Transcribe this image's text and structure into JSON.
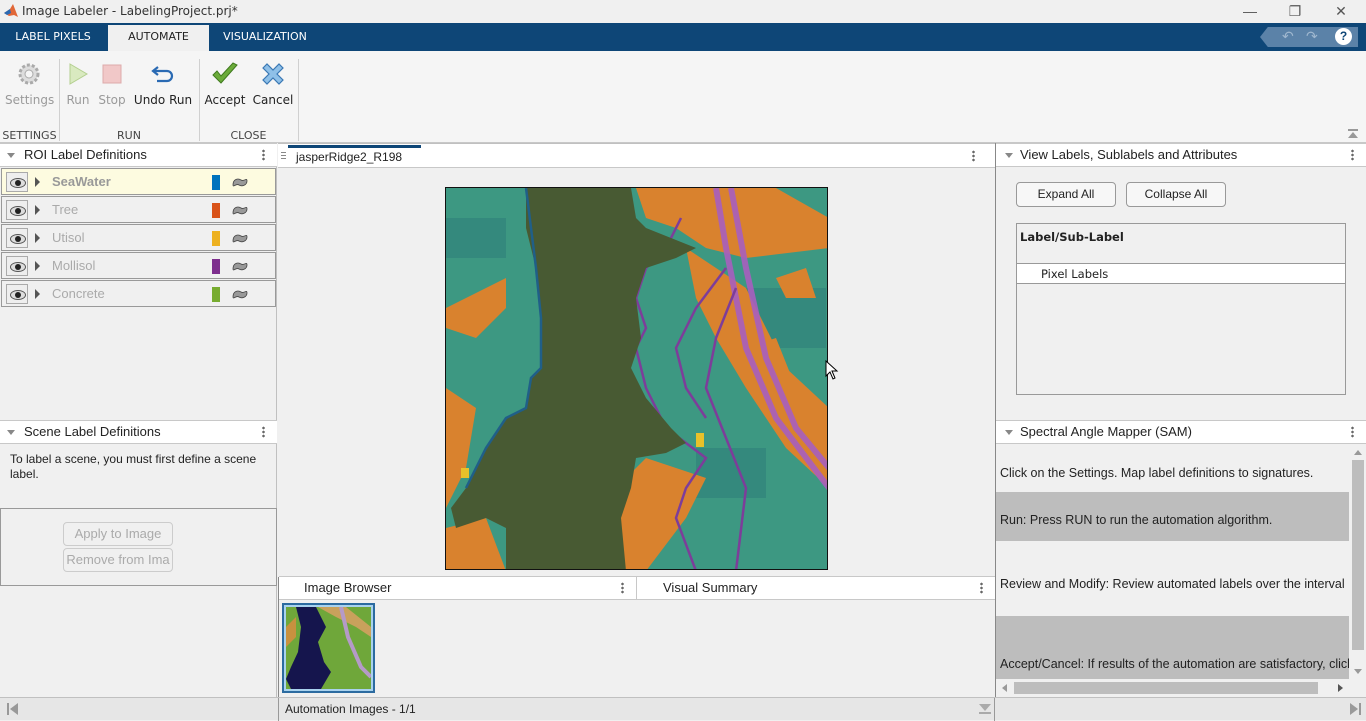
{
  "window": {
    "title": "Image Labeler - LabelingProject.prj*",
    "controls": [
      "minimize",
      "restore",
      "close"
    ]
  },
  "tabs": [
    {
      "label": "LABEL PIXELS",
      "active": false
    },
    {
      "label": "AUTOMATE",
      "active": true
    },
    {
      "label": "VISUALIZATION",
      "active": false
    }
  ],
  "quick_access": [
    "undo-icon",
    "redo-icon",
    "help-icon"
  ],
  "toolstrip": {
    "settings": {
      "label": "Settings",
      "enabled": false
    },
    "run": {
      "label": "Run",
      "enabled": false
    },
    "stop": {
      "label": "Stop",
      "enabled": false
    },
    "undo_run": {
      "label": "Undo Run",
      "enabled": true
    },
    "accept": {
      "label": "Accept",
      "enabled": true
    },
    "cancel": {
      "label": "Cancel",
      "enabled": true
    },
    "sections": {
      "settings": "SETTINGS",
      "run": "RUN",
      "close": "CLOSE"
    }
  },
  "roi_panel": {
    "title": "ROI Label Definitions",
    "labels": [
      {
        "name": "SeaWater",
        "color": "#0072bd",
        "selected": true
      },
      {
        "name": "Tree",
        "color": "#d95319",
        "selected": false
      },
      {
        "name": "Utisol",
        "color": "#edb120",
        "selected": false
      },
      {
        "name": "Mollisol",
        "color": "#7e2f8e",
        "selected": false
      },
      {
        "name": "Concrete",
        "color": "#77ac30",
        "selected": false
      }
    ]
  },
  "scene_panel": {
    "title": "Scene Label Definitions",
    "message": "To label a scene, you must first define a scene label.",
    "apply_button": "Apply to Image",
    "remove_button": "Remove from Ima"
  },
  "document": {
    "tab_label": "jasperRidge2_R198"
  },
  "image_browser": {
    "title": "Image Browser",
    "status": "Automation Images - 1/1"
  },
  "visual_summary": {
    "title": "Visual Summary"
  },
  "view_labels_panel": {
    "title": "View Labels, Sublabels and Attributes",
    "expand_all": "Expand All",
    "collapse_all": "Collapse All",
    "table_header": "Label/Sub-Label",
    "rows": [
      "Pixel Labels"
    ]
  },
  "sam_panel": {
    "title": "Spectral Angle Mapper (SAM)",
    "steps": [
      {
        "text": "Click on the Settings. Map label definitions to signatures.",
        "highlight": false
      },
      {
        "text": "Run: Press RUN to run the automation algorithm.",
        "highlight": true
      },
      {
        "text": "Review and Modify: Review automated labels over the interval",
        "highlight": false
      },
      {
        "text": "Accept/Cancel: If results of the automation are satisfactory, click Accept",
        "highlight": true
      }
    ]
  }
}
